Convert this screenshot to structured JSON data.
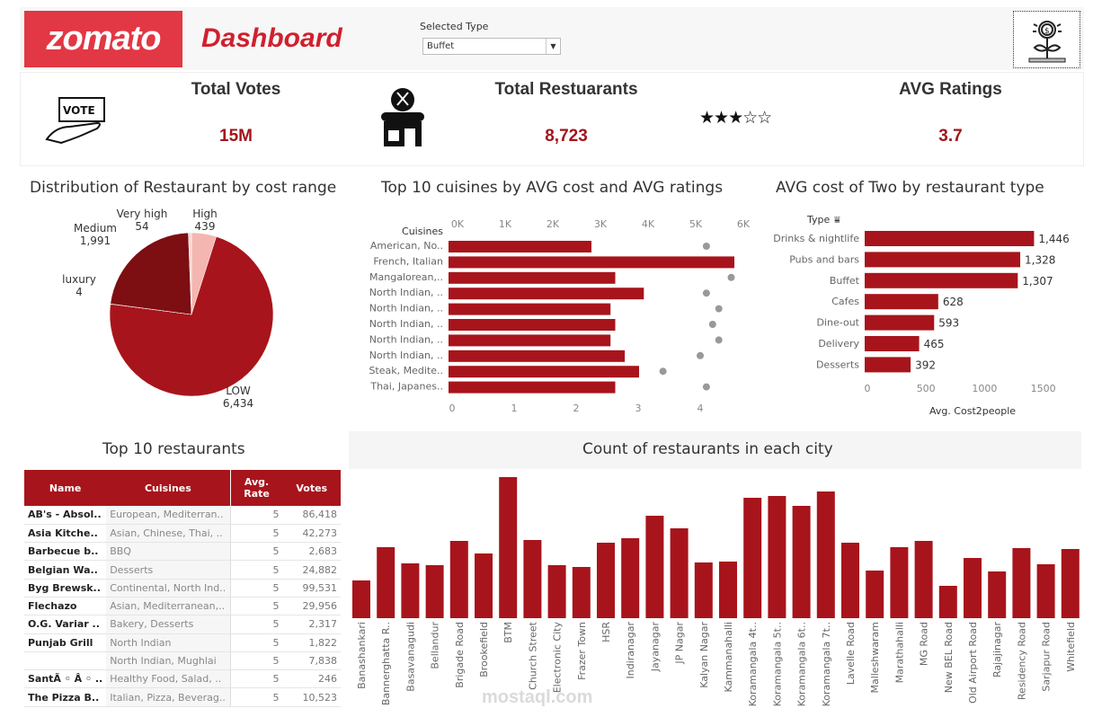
{
  "header": {
    "logo": "zomato",
    "title": "Dashboard",
    "filter_label": "Selected Type",
    "filter_value": "Buffet"
  },
  "kpis": {
    "votes_label": "Total Votes",
    "votes_value": "15M",
    "restaurants_label": "Total Restuarants",
    "restaurants_value": "8,723",
    "ratings_label": "AVG Ratings",
    "ratings_value": "3.7",
    "stars_filled": 3,
    "stars_total": 5
  },
  "icons": {
    "vote": "vote-hand-icon",
    "store": "restaurant-store-icon",
    "stars": "star-rating-icon",
    "money_plant": "money-plant-icon"
  },
  "colors": {
    "brand": "#e23744",
    "bar": "#a8141b",
    "value": "#a3141c",
    "pie_low": "#a8141b",
    "pie_medium": "#7d0e12",
    "pie_high": "#f4b6b0",
    "dot": "#999999"
  },
  "chart_data": [
    {
      "type": "pie",
      "title": "Distribution of Restaurant by cost range",
      "slices": [
        {
          "label": "High",
          "value": 439,
          "display": "439"
        },
        {
          "label": "LOW",
          "value": 6434,
          "display": "6,434"
        },
        {
          "label": "luxury",
          "value": 4,
          "display": "4"
        },
        {
          "label": "Medium",
          "value": 1991,
          "display": "1,991"
        },
        {
          "label": "Very high",
          "value": 54,
          "display": "54"
        }
      ]
    },
    {
      "type": "bar",
      "title": "Top 10 cuisines by AVG cost and AVG ratings",
      "ylabel": "Cuisines",
      "categories": [
        "American, No..",
        "French, Italian",
        "Mangalorean,..",
        "North Indian, ..",
        "North Indian, ..",
        "North Indian, ..",
        "North Indian, ..",
        "North Indian, ..",
        "Steak, Medite..",
        "Thai, Japanes.."
      ],
      "series": [
        {
          "values": [
            3000,
            6000,
            3500,
            4100,
            3400,
            3500,
            3400,
            3700,
            4000,
            3500
          ]
        },
        {
          "values": [
            4.1,
            null,
            4.5,
            4.1,
            4.3,
            4.2,
            4.3,
            4.0,
            3.4,
            4.1
          ]
        }
      ],
      "top_axis": {
        "range": [
          0,
          6000
        ],
        "ticks": [
          "0K",
          "1K",
          "2K",
          "3K",
          "4K",
          "5K",
          "6K"
        ]
      },
      "bottom_axis": {
        "range": [
          0,
          4.6
        ],
        "ticks": [
          "0",
          "1",
          "2",
          "3",
          "4"
        ]
      }
    },
    {
      "type": "bar",
      "title": "AVG cost of Two by restaurant type",
      "ylabel": "Type",
      "xlabel": "Avg. Cost2people",
      "categories": [
        "Drinks & nightlife",
        "Pubs and bars",
        "Buffet",
        "Cafes",
        "Dine-out",
        "Delivery",
        "Desserts"
      ],
      "values": [
        1446,
        1328,
        1307,
        628,
        593,
        465,
        392
      ],
      "labels": [
        "1,446",
        "1,328",
        "1,307",
        "628",
        "593",
        "465",
        "392"
      ],
      "xlim": [
        0,
        1750
      ],
      "ticks": [
        "0",
        "500",
        "1000",
        "1500"
      ]
    },
    {
      "type": "bar",
      "title": "Count of restaurants in each city",
      "categories": [
        "Banashankari",
        "Bannerghatta R..",
        "Basavanagudi",
        "Bellandur",
        "Brigade Road",
        "Brookefield",
        "BTM",
        "Church Street",
        "Electronic City",
        "Frazer Town",
        "HSR",
        "Indiranagar",
        "Jayanagar",
        "JP Nagar",
        "Kalyan Nagar",
        "Kammanahalli",
        "Koramangala 4t..",
        "Koramangala 5t..",
        "Koramangala 6t..",
        "Koramangala 7t..",
        "Lavelle Road",
        "Malleshwaram",
        "Marathahalli",
        "MG Road",
        "New BEL Road",
        "Old Airport Road",
        "Rajajinagar",
        "Residency Road",
        "Sarjapur Road",
        "Whitefield"
      ],
      "values": [
        42,
        79,
        61,
        59,
        86,
        72,
        157,
        87,
        59,
        57,
        84,
        89,
        114,
        100,
        62,
        63,
        134,
        136,
        125,
        141,
        84,
        53,
        79,
        86,
        36,
        67,
        52,
        78,
        60,
        77
      ]
    }
  ],
  "table": {
    "title": "Top 10 restaurants",
    "columns": [
      "Name",
      "Cuisines",
      "Avg. Rate",
      "Votes"
    ],
    "rows": [
      [
        "AB's - Absol..",
        "European, Mediterran..",
        "5",
        "86,418"
      ],
      [
        "Asia Kitche..",
        "Asian, Chinese, Thai, ..",
        "5",
        "42,273"
      ],
      [
        "Barbecue b..",
        "BBQ",
        "5",
        "2,683"
      ],
      [
        "Belgian Wa..",
        "Desserts",
        "5",
        "24,882"
      ],
      [
        "Byg Brewsk..",
        "Continental, North Ind..",
        "5",
        "99,531"
      ],
      [
        "Flechazo",
        "Asian, Mediterranean,..",
        "5",
        "29,956"
      ],
      [
        "O.G. Variar ..",
        "Bakery, Desserts",
        "5",
        "2,317"
      ],
      [
        "Punjab Grill",
        "North Indian",
        "5",
        "1,822"
      ],
      [
        "",
        "North Indian, Mughlai",
        "5",
        "7,838"
      ],
      [
        "SantÃ ◦ Â ◦ ..",
        "Healthy Food, Salad, ..",
        "5",
        "246"
      ],
      [
        "The Pizza B..",
        "Italian, Pizza, Beverag..",
        "5",
        "10,523"
      ]
    ]
  },
  "watermark": "mostaql.com"
}
